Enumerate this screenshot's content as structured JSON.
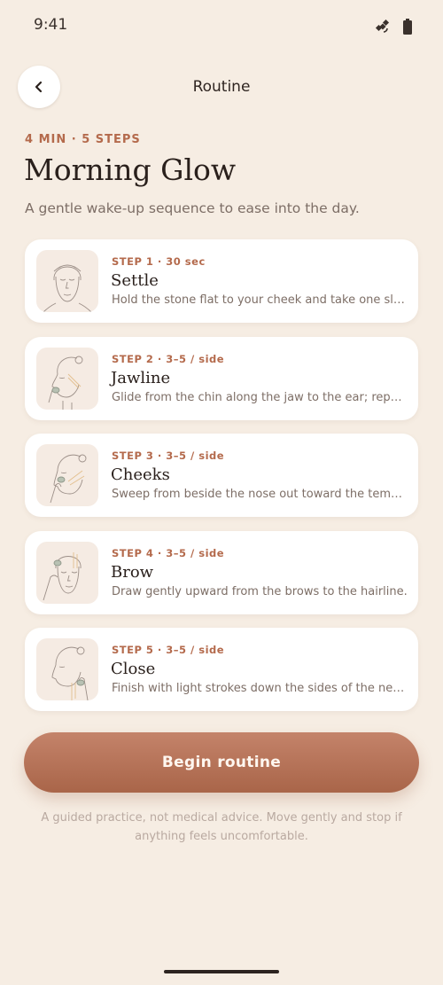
{
  "status": {
    "time": "9:41"
  },
  "appbar": {
    "title": "Routine"
  },
  "routine": {
    "meta": "4 MIN · 5 STEPS",
    "title": "Morning Glow",
    "subtitle": "A gentle wake-up sequence to ease into the day."
  },
  "steps": [
    {
      "meta": "STEP 1 · 30 sec",
      "name": "Settle",
      "desc": "Hold the stone flat to your cheek and take one slow breath."
    },
    {
      "meta": "STEP 2 · 3–5 / side",
      "name": "Jawline",
      "desc": "Glide from the chin along the jaw to the ear; repeat."
    },
    {
      "meta": "STEP 3 · 3–5 / side",
      "name": "Cheeks",
      "desc": "Sweep from beside the nose out toward the temples."
    },
    {
      "meta": "STEP 4 · 3–5 / side",
      "name": "Brow",
      "desc": "Draw gently upward from the brows to the hairline."
    },
    {
      "meta": "STEP 5 · 3–5 / side",
      "name": "Close",
      "desc": "Finish with light strokes down the sides of the neck."
    }
  ],
  "cta": {
    "label": "Begin routine"
  },
  "disclaimer": "A guided practice, not medical advice. Move gently and stop if anything feels uncomfortable.",
  "icons": [
    "back-chevron-icon",
    "satellite-icon",
    "battery-icon",
    "face-illustration-icon"
  ],
  "colors": {
    "accent": "#b46a4c",
    "background": "#f6ede3",
    "button": "#b87358"
  }
}
